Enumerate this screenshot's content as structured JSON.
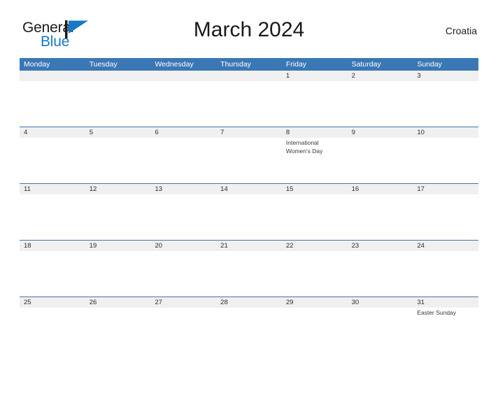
{
  "brand": {
    "name_part1": "General",
    "name_part2": "Blue",
    "flag_icon": "flag-triangle-icon",
    "flag_color": "#1878c8",
    "pole_color": "#1b1b1b"
  },
  "header": {
    "title": "March 2024",
    "country": "Croatia"
  },
  "theme": {
    "header_blue": "#3a77b5",
    "band_gray": "#f0f0f0",
    "separator_blue": "#3a77b5",
    "text_dark": "#2b2b2b",
    "logo_blue": "#1878c8"
  },
  "calendar": {
    "weekdays": [
      "Monday",
      "Tuesday",
      "Wednesday",
      "Thursday",
      "Friday",
      "Saturday",
      "Sunday"
    ],
    "weeks": [
      {
        "days": [
          {
            "num": "",
            "event": ""
          },
          {
            "num": "",
            "event": ""
          },
          {
            "num": "",
            "event": ""
          },
          {
            "num": "",
            "event": ""
          },
          {
            "num": "1",
            "event": ""
          },
          {
            "num": "2",
            "event": ""
          },
          {
            "num": "3",
            "event": ""
          }
        ]
      },
      {
        "days": [
          {
            "num": "4",
            "event": ""
          },
          {
            "num": "5",
            "event": ""
          },
          {
            "num": "6",
            "event": ""
          },
          {
            "num": "7",
            "event": ""
          },
          {
            "num": "8",
            "event": "International Women's Day"
          },
          {
            "num": "9",
            "event": ""
          },
          {
            "num": "10",
            "event": ""
          }
        ]
      },
      {
        "days": [
          {
            "num": "11",
            "event": ""
          },
          {
            "num": "12",
            "event": ""
          },
          {
            "num": "13",
            "event": ""
          },
          {
            "num": "14",
            "event": ""
          },
          {
            "num": "15",
            "event": ""
          },
          {
            "num": "16",
            "event": ""
          },
          {
            "num": "17",
            "event": ""
          }
        ]
      },
      {
        "days": [
          {
            "num": "18",
            "event": ""
          },
          {
            "num": "19",
            "event": ""
          },
          {
            "num": "20",
            "event": ""
          },
          {
            "num": "21",
            "event": ""
          },
          {
            "num": "22",
            "event": ""
          },
          {
            "num": "23",
            "event": ""
          },
          {
            "num": "24",
            "event": ""
          }
        ]
      },
      {
        "days": [
          {
            "num": "25",
            "event": ""
          },
          {
            "num": "26",
            "event": ""
          },
          {
            "num": "27",
            "event": ""
          },
          {
            "num": "28",
            "event": ""
          },
          {
            "num": "29",
            "event": ""
          },
          {
            "num": "30",
            "event": ""
          },
          {
            "num": "31",
            "event": "Easter Sunday"
          }
        ]
      }
    ]
  }
}
